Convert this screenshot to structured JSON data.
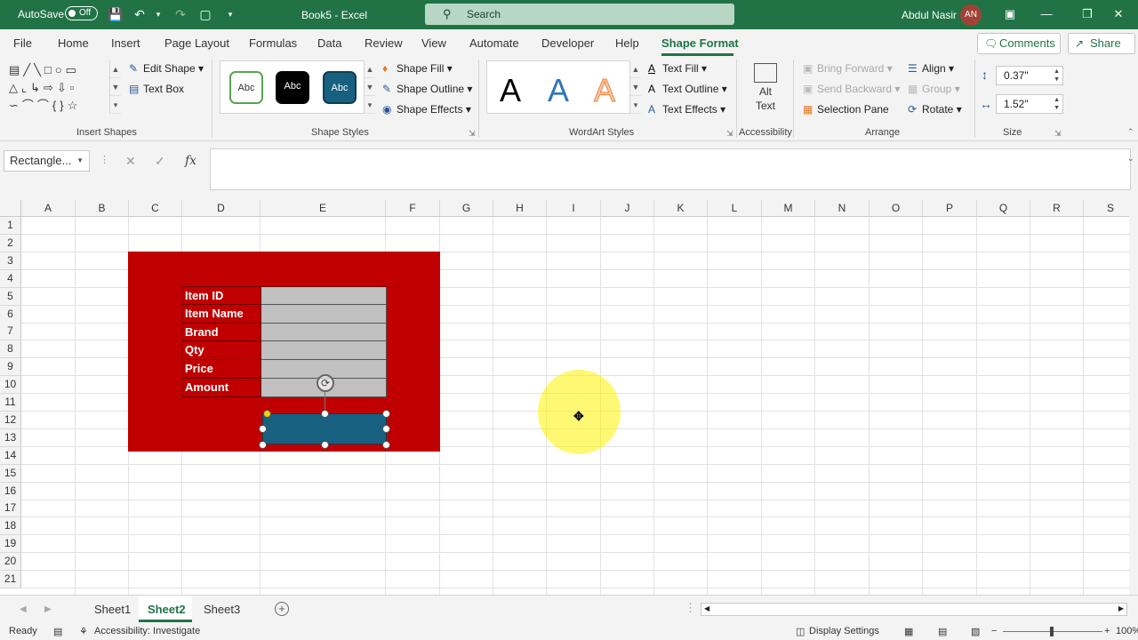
{
  "titlebar": {
    "autosave_label": "AutoSave",
    "autosave_state": "Off",
    "document": "Book5 - Excel",
    "search_label": "Search",
    "user_name": "Abdul Nasir",
    "user_initials": "AN"
  },
  "menu": {
    "tabs": [
      "File",
      "Home",
      "Insert",
      "Page Layout",
      "Formulas",
      "Data",
      "Review",
      "View",
      "Automate",
      "Developer",
      "Help",
      "Shape Format"
    ],
    "active_tab": "Shape Format",
    "comments_label": "Comments",
    "share_label": "Share"
  },
  "ribbon": {
    "insert_shapes": {
      "edit_shape": "Edit Shape",
      "text_box": "Text Box",
      "label": "Insert Shapes"
    },
    "shape_styles": {
      "swatch_label": "Abc",
      "shape_fill": "Shape Fill",
      "shape_outline": "Shape Outline",
      "shape_effects": "Shape Effects",
      "label": "Shape Styles"
    },
    "wordart": {
      "letter": "A",
      "text_fill": "Text Fill",
      "text_outline": "Text Outline",
      "text_effects": "Text Effects",
      "label": "WordArt Styles"
    },
    "accessibility": {
      "alt_text_line1": "Alt",
      "alt_text_line2": "Text",
      "label": "Accessibility"
    },
    "arrange": {
      "bring_forward": "Bring Forward",
      "send_backward": "Send Backward",
      "selection_pane": "Selection Pane",
      "align": "Align",
      "group": "Group",
      "rotate": "Rotate",
      "label": "Arrange"
    },
    "size": {
      "height": "0.37\"",
      "width": "1.52\"",
      "label": "Size"
    }
  },
  "formula_bar": {
    "name_box": "Rectangle...",
    "fx": "fx"
  },
  "sheet": {
    "columns": [
      "A",
      "B",
      "C",
      "D",
      "E",
      "F",
      "G",
      "H",
      "I",
      "J",
      "K",
      "L",
      "M",
      "N",
      "O",
      "P",
      "Q",
      "R",
      "S"
    ],
    "rows": [
      "1",
      "2",
      "3",
      "4",
      "5",
      "6",
      "7",
      "8",
      "9",
      "10",
      "11",
      "12",
      "13",
      "14",
      "15",
      "16",
      "17",
      "18",
      "19",
      "20",
      "21"
    ],
    "form_labels": [
      "Item ID",
      "Item Name",
      "Brand",
      "Qty",
      "Price",
      "Amount"
    ]
  },
  "sheet_tabs": {
    "tabs": [
      "Sheet1",
      "Sheet2",
      "Sheet3"
    ],
    "active": "Sheet2"
  },
  "status": {
    "ready": "Ready",
    "accessibility": "Accessibility: Investigate",
    "display_settings": "Display Settings",
    "zoom": "100%"
  },
  "colors": {
    "accent": "#217346",
    "panel_red": "#c00000",
    "button_teal": "#17607f",
    "field_gray": "#c0c0c0"
  }
}
